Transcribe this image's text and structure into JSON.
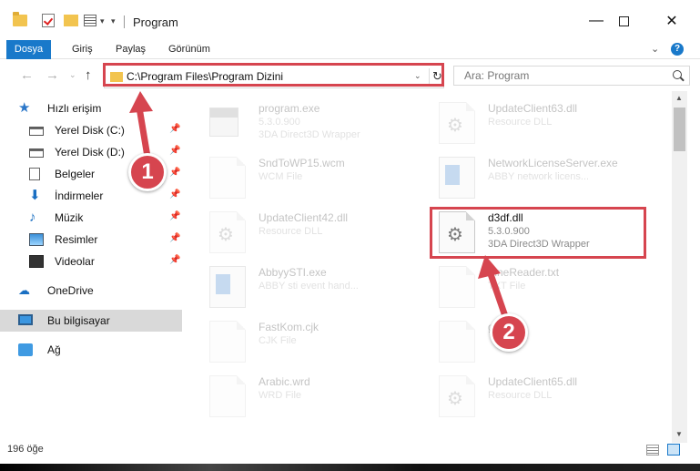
{
  "window": {
    "title": "Program",
    "minimize_glyph": "—",
    "close_glyph": "✕"
  },
  "ribbon": {
    "tabs": [
      "Dosya",
      "Giriş",
      "Paylaş",
      "Görünüm"
    ],
    "help": "?"
  },
  "address": {
    "path": "C:\\Program Files\\Program Dizini",
    "search_placeholder": "Ara: Program"
  },
  "sidebar": {
    "items": [
      {
        "label": "Hızlı erişim",
        "icon": "star-icon"
      },
      {
        "label": "Yerel Disk (C:)",
        "icon": "drive-icon",
        "pinned": true
      },
      {
        "label": "Yerel Disk (D:)",
        "icon": "drive-icon",
        "pinned": true
      },
      {
        "label": "Belgeler",
        "icon": "document-icon",
        "pinned": true
      },
      {
        "label": "İndirmeler",
        "icon": "download-icon",
        "pinned": true
      },
      {
        "label": "Müzik",
        "icon": "music-icon",
        "pinned": true
      },
      {
        "label": "Resimler",
        "icon": "picture-icon",
        "pinned": true
      },
      {
        "label": "Videolar",
        "icon": "video-icon",
        "pinned": true
      },
      {
        "label": "OneDrive",
        "icon": "cloud-icon"
      },
      {
        "label": "Bu bilgisayar",
        "icon": "computer-icon",
        "selected": true
      },
      {
        "label": "Ağ",
        "icon": "network-icon"
      }
    ]
  },
  "files": [
    {
      "name": "program.exe",
      "meta1": "5.3.0.900",
      "meta2": "3DA Direct3D Wrapper",
      "icon": "exe"
    },
    {
      "name": "UpdateClient63.dll",
      "meta1": "Resource DLL",
      "meta2": "",
      "icon": "dll"
    },
    {
      "name": "SndToWP15.wcm",
      "meta1": "WCM File",
      "meta2": "",
      "icon": "page"
    },
    {
      "name": "NetworkLicenseServer.exe",
      "meta1": "ABBY network licens...",
      "meta2": "",
      "icon": "win"
    },
    {
      "name": "UpdateClient42.dll",
      "meta1": "Resource DLL",
      "meta2": "",
      "icon": "dll"
    },
    {
      "name": "d3df.dll",
      "meta1": "5.3.0.900",
      "meta2": "3DA Direct3D Wrapper",
      "icon": "dll",
      "highlighted": true
    },
    {
      "name": "AbbyySTI.exe",
      "meta1": "ABBY sti event hand...",
      "meta2": "",
      "icon": "win"
    },
    {
      "name": "FineReader.txt",
      "meta1": "TXT File",
      "meta2": "",
      "icon": "page"
    },
    {
      "name": "FastKom.cjk",
      "meta1": "CJK File",
      "meta2": "",
      "icon": "page"
    },
    {
      "name": "gt",
      "meta1": "",
      "meta2": "",
      "icon": "page"
    },
    {
      "name": "Arabic.wrd",
      "meta1": "WRD File",
      "meta2": "",
      "icon": "page"
    },
    {
      "name": "UpdateClient65.dll",
      "meta1": "Resource DLL",
      "meta2": "",
      "icon": "dll"
    }
  ],
  "status": {
    "count": "196 öğe"
  },
  "callouts": {
    "one": "1",
    "two": "2"
  },
  "colors": {
    "accent": "#1979ca",
    "highlight": "#d6454f"
  }
}
